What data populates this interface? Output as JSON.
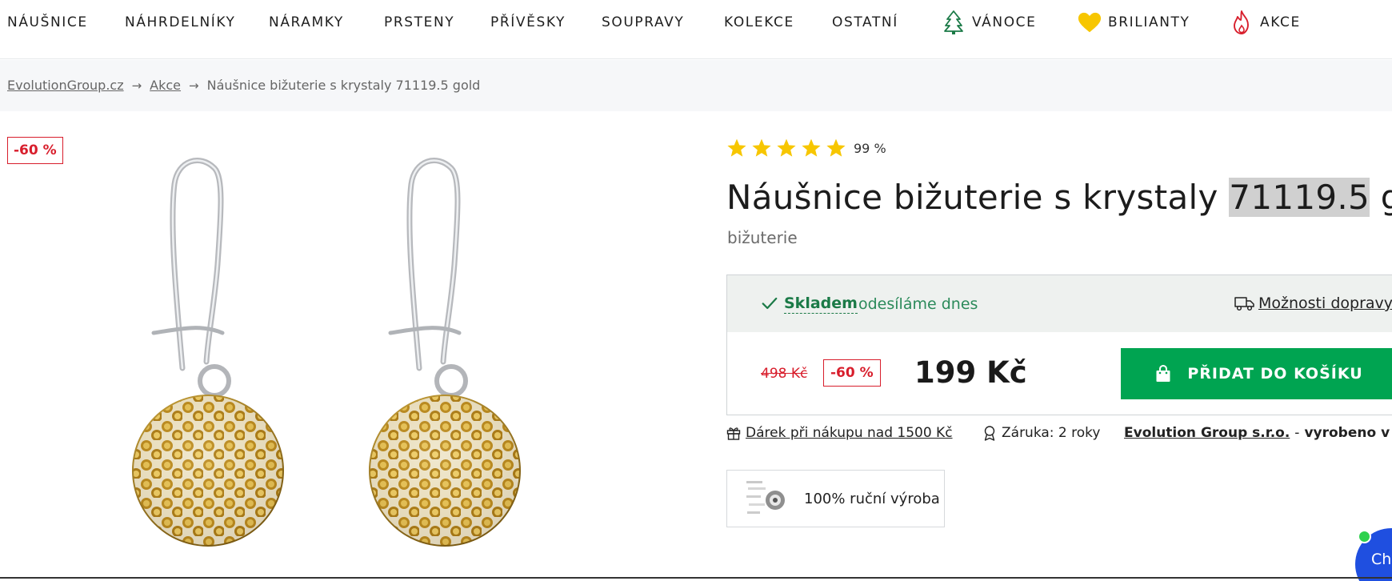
{
  "nav": {
    "items": [
      {
        "label": "NÁUŠNICE"
      },
      {
        "label": "NÁHRDELNÍKY"
      },
      {
        "label": "NÁRAMKY"
      },
      {
        "label": "PRSTENY"
      },
      {
        "label": "PŘÍVĚSKY"
      },
      {
        "label": "SOUPRAVY"
      },
      {
        "label": "KOLEKCE"
      },
      {
        "label": "OSTATNÍ"
      },
      {
        "label": "VÁNOCE",
        "icon": "tree-icon"
      },
      {
        "label": "BRILIANTY",
        "icon": "heart-icon"
      },
      {
        "label": "AKCE",
        "icon": "fire-icon"
      }
    ]
  },
  "breadcrumb": {
    "items": [
      "EvolutionGroup.cz",
      "Akce",
      "Náušnice bižuterie s krystaly 71119.5 gold"
    ]
  },
  "image": {
    "discount_badge": "-60 %"
  },
  "product": {
    "rating": "99 %",
    "rating_stars": 5,
    "title_before": "Náušnice bižuterie s krystaly ",
    "title_highlight": "71119.5",
    "title_after": " gold",
    "category": "bižuterie"
  },
  "availability": {
    "status": "Skladem",
    "note": "odesíláme dnes",
    "delivery_link": "Možnosti dopravy"
  },
  "pricing": {
    "old_price": "498 Kč",
    "discount": "-60 %",
    "price": "199 Kč",
    "add_to_cart": "PŘIDAT DO KOŠÍKU"
  },
  "info": {
    "gift": "Dárek při nákupu nad 1500 Kč",
    "warranty": "Záruka: 2 roky",
    "maker_company": "Evolution Group s.r.o.",
    "maker_separator": " - ",
    "maker_origin": "vyrobeno v ČR"
  },
  "badges": {
    "handmade": "100% ruční výroba"
  },
  "chat": {
    "label": "Cha"
  },
  "colors": {
    "accent_green": "#00a451",
    "sale_red": "#d81e2c",
    "star_yellow": "#f7c600",
    "stock_green": "#1b7a47",
    "chat_blue": "#1f4fe0"
  }
}
